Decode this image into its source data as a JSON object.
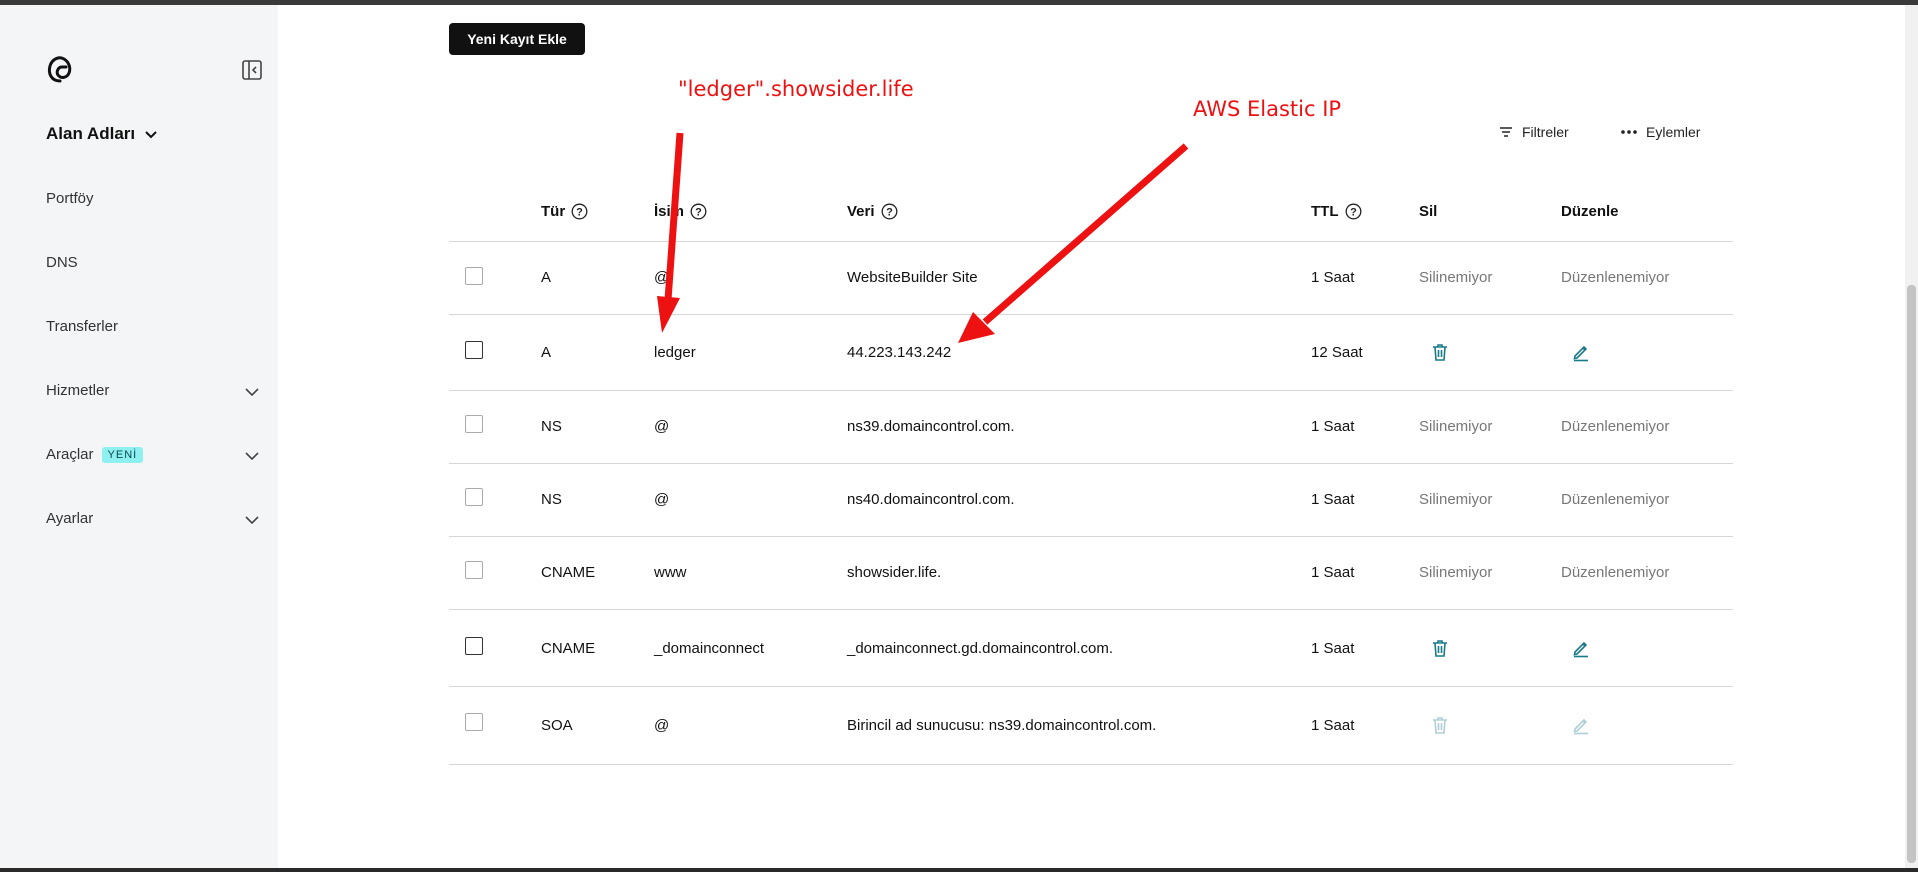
{
  "sidebar": {
    "section_title": "Alan Adları",
    "items": [
      {
        "label": "Portföy",
        "has_chevron": false
      },
      {
        "label": "DNS",
        "has_chevron": false
      },
      {
        "label": "Transferler",
        "has_chevron": false
      },
      {
        "label": "Hizmetler",
        "has_chevron": true
      },
      {
        "label": "Araçlar",
        "badge": "YENİ",
        "has_chevron": true
      },
      {
        "label": "Ayarlar",
        "has_chevron": true
      }
    ]
  },
  "toolbar": {
    "add_button": "Yeni Kayıt Ekle",
    "filters": "Filtreler",
    "actions": "Eylemler"
  },
  "annotations": {
    "left_label": "\"ledger\".showsider.life",
    "right_label": "AWS Elastic IP",
    "color": "#ee1111"
  },
  "table": {
    "headers": {
      "type": "Tür",
      "name": "İsim",
      "data": "Veri",
      "ttl": "TTL",
      "delete": "Sil",
      "edit": "Düzenle"
    },
    "rows": [
      {
        "type": "A",
        "name": "@",
        "data": "WebsiteBuilder Site",
        "ttl": "1 Saat",
        "delete": "Silinemiyor",
        "edit": "Düzenlenemiyor",
        "editable": false
      },
      {
        "type": "A",
        "name": "ledger",
        "data": "44.223.143.242",
        "ttl": "12 Saat",
        "delete": "",
        "edit": "",
        "editable": true
      },
      {
        "type": "NS",
        "name": "@",
        "data": "ns39.domaincontrol.com.",
        "ttl": "1 Saat",
        "delete": "Silinemiyor",
        "edit": "Düzenlenemiyor",
        "editable": false
      },
      {
        "type": "NS",
        "name": "@",
        "data": "ns40.domaincontrol.com.",
        "ttl": "1 Saat",
        "delete": "Silinemiyor",
        "edit": "Düzenlenemiyor",
        "editable": false
      },
      {
        "type": "CNAME",
        "name": "www",
        "data": "showsider.life.",
        "ttl": "1 Saat",
        "delete": "Silinemiyor",
        "edit": "Düzenlenemiyor",
        "editable": false
      },
      {
        "type": "CNAME",
        "name": "_domainconnect",
        "data": "_domainconnect.gd.domaincontrol.com.",
        "ttl": "1 Saat",
        "delete": "",
        "edit": "",
        "editable": true
      },
      {
        "type": "SOA",
        "name": "@",
        "data": "Birincil ad sunucusu: ns39.domaincontrol.com.",
        "ttl": "1 Saat",
        "delete": "",
        "edit": "",
        "editable": "disabled"
      }
    ]
  },
  "colors": {
    "accent": "#1a7a8a",
    "sidebar_bg": "#f4f5f7",
    "badge_bg": "#8ff0f0"
  }
}
